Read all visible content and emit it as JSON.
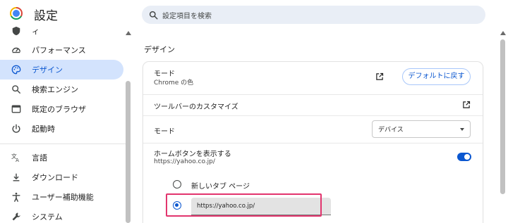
{
  "header": {
    "title": "設定",
    "search_placeholder": "設定項目を検索"
  },
  "sidebar": {
    "items": [
      {
        "label": "ィ",
        "icon": "privacy-shield-icon"
      },
      {
        "label": "パフォーマンス",
        "icon": "speedometer-icon"
      },
      {
        "label": "デザイン",
        "icon": "palette-icon",
        "active": true
      },
      {
        "label": "検索エンジン",
        "icon": "search-icon"
      },
      {
        "label": "既定のブラウザ",
        "icon": "browser-window-icon"
      },
      {
        "label": "起動時",
        "icon": "power-icon"
      },
      {
        "label": "言語",
        "icon": "translate-icon"
      },
      {
        "label": "ダウンロード",
        "icon": "download-icon"
      },
      {
        "label": "ユーザー補助機能",
        "icon": "accessibility-icon"
      },
      {
        "label": "システム",
        "icon": "wrench-icon"
      }
    ]
  },
  "main": {
    "section_title": "デザイン",
    "theme": {
      "label": "モード",
      "sublabel": "Chrome の色",
      "reset_label": "デフォルトに戻す"
    },
    "toolbar_customize": {
      "label": "ツールバーのカスタマイズ"
    },
    "mode": {
      "label": "モード",
      "selected": "デバイス"
    },
    "home_button": {
      "label": "ホームボタンを表示する",
      "sublabel": "https://yahoo.co.jp/",
      "enabled": true,
      "option_new_tab": "新しいタブ ページ",
      "custom_url_value": "https://yahoo.co.jp/"
    }
  },
  "colors": {
    "accent": "#0b57d0",
    "active_nav_bg": "#d3e3fd",
    "highlight_border": "#e2356e",
    "search_bg": "#e9eef6"
  }
}
